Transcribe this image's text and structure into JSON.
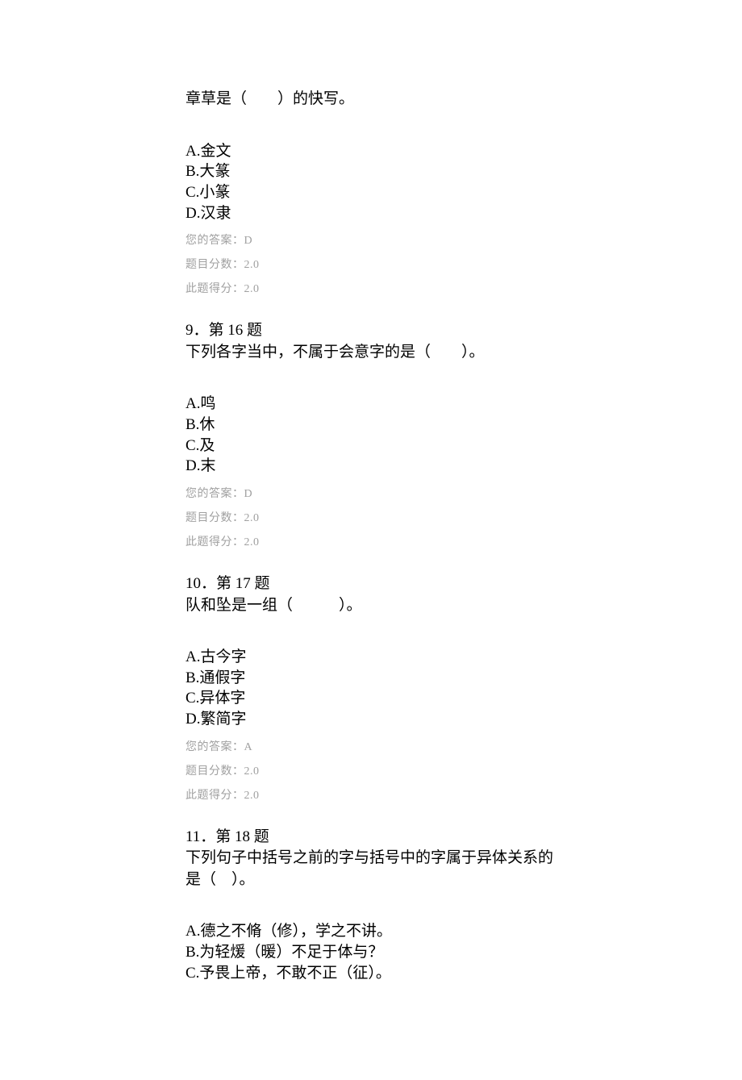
{
  "q8": {
    "stem": "章草是（　　）的快写。",
    "options": {
      "a": "A.金文",
      "b": "B.大篆",
      "c": "C.小篆",
      "d": "D.汉隶"
    },
    "your_answer": "您的答案：D",
    "max_score": "题目分数：2.0",
    "earned_score": "此题得分：2.0"
  },
  "q9": {
    "header": "9．第 16 题",
    "stem": "下列各字当中，不属于会意字的是（　　）。",
    "options": {
      "a": "A.鸣",
      "b": "B.休",
      "c": "C.及",
      "d": "D.末"
    },
    "your_answer": "您的答案：D",
    "max_score": "题目分数：2.0",
    "earned_score": "此题得分：2.0"
  },
  "q10": {
    "header": "10．第 17 题",
    "stem": "队和坠是一组（　　　）。",
    "options": {
      "a": "A.古今字",
      "b": "B.通假字",
      "c": "C.异体字",
      "d": "D.繁简字"
    },
    "your_answer": "您的答案：A",
    "max_score": "题目分数：2.0",
    "earned_score": "此题得分：2.0"
  },
  "q11": {
    "header": "11．第 18 题",
    "stem": "下列句子中括号之前的字与括号中的字属于异体关系的是（　）。",
    "options": {
      "a": "A.德之不脩（修），学之不讲。",
      "b": "B.为轻煖（暖）不足于体与？",
      "c": "C.予畏上帝，不敢不正（征）。"
    }
  }
}
